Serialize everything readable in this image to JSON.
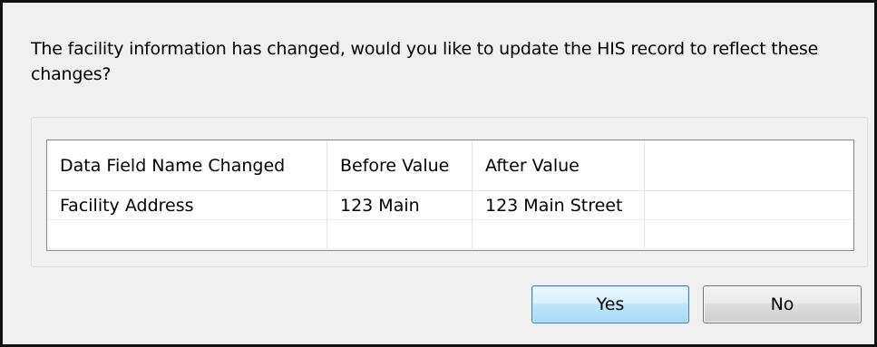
{
  "dialog": {
    "message": "The facility information has changed, would you like to update the HIS record to reflect these changes?"
  },
  "table": {
    "columns": [
      "Data Field Name Changed",
      "Before Value",
      "After Value",
      ""
    ],
    "rows": [
      [
        "Facility Address",
        "123 Main",
        "123 Main Street",
        ""
      ],
      [
        "",
        "",
        "",
        ""
      ]
    ]
  },
  "buttons": {
    "yes_label": "Yes",
    "no_label": "No"
  },
  "colors": {
    "dialog_background": "#f0f0f0",
    "dialog_border": "#111111",
    "default_button_border": "#3c7fb1",
    "default_button_fill": "#bee6fd"
  }
}
